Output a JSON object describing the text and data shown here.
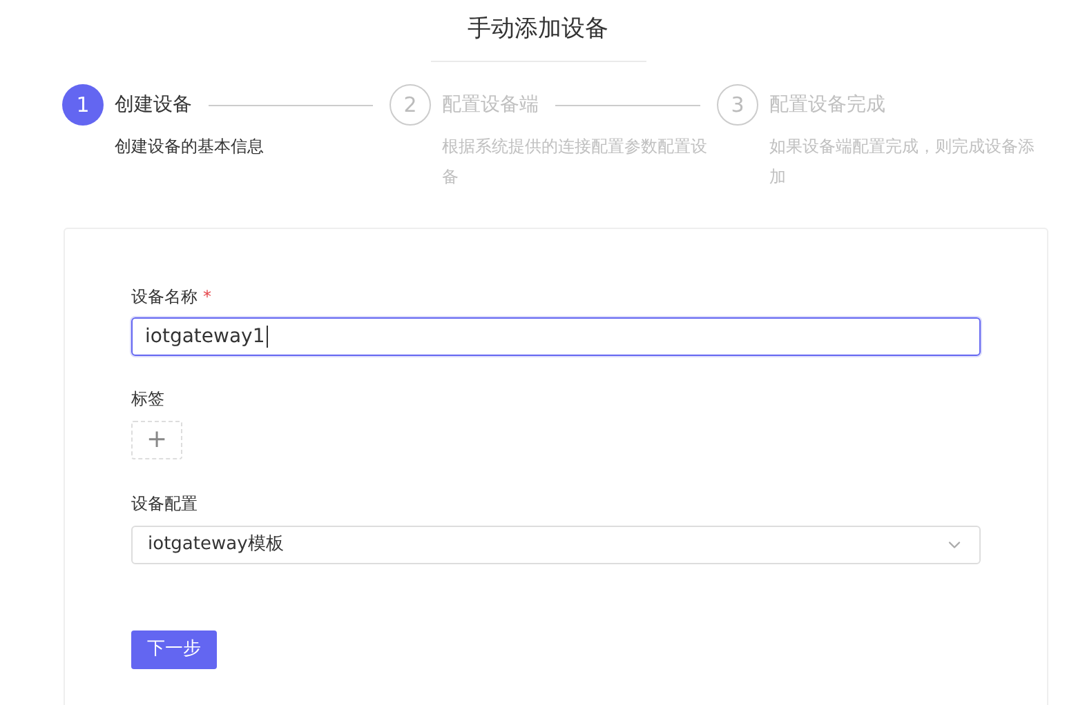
{
  "title": "手动添加设备",
  "steps": [
    {
      "number": "1",
      "title": "创建设备",
      "description": "创建设备的基本信息",
      "selected": true
    },
    {
      "number": "2",
      "title": "配置设备端",
      "description": "根据系统提供的连接配置参数配置设备",
      "selected": false
    },
    {
      "number": "3",
      "title": "配置设备完成",
      "description": "如果设备端配置完成，则完成设备添加",
      "selected": false
    }
  ],
  "form": {
    "name_field": {
      "label": "设备名称",
      "required_mark": "*",
      "value": "iotgateway1",
      "focused": true
    },
    "tags": {
      "label": "标签",
      "add_symbol": "+"
    },
    "config_select": {
      "label": "设备配置",
      "value": "iotgateway模板"
    },
    "next_button": "下一步"
  }
}
